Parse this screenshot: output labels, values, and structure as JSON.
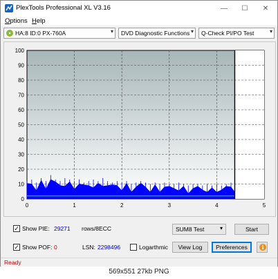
{
  "window": {
    "title": "PlexTools Professional XL V3.16",
    "minimize_glyph": "—",
    "maximize_glyph": "☐",
    "close_glyph": "✕"
  },
  "menu": [
    {
      "label": "Options",
      "underline": "O",
      "rest": "ptions"
    },
    {
      "label": "Help",
      "underline": "H",
      "rest": "elp"
    }
  ],
  "toolbar": {
    "drive": "HA:8 ID:0  PX-760A",
    "function": "DVD Diagnostic Functions",
    "test": "Q-Check PI/PO Test"
  },
  "chart_data": {
    "type": "area",
    "title": "",
    "xlabel": "",
    "ylabel": "",
    "xlim": [
      0,
      5
    ],
    "ylim": [
      0,
      100
    ],
    "x_ticks": [
      "0",
      "1",
      "2",
      "3",
      "4",
      "5"
    ],
    "y_ticks": [
      "0",
      "10",
      "20",
      "30",
      "40",
      "50",
      "60",
      "70",
      "80",
      "90",
      "100"
    ],
    "grid": true,
    "end_marker_x": 4.38,
    "series": [
      {
        "color": "#0000ff",
        "x": [
          0,
          0.1,
          0.2,
          0.3,
          0.4,
          0.5,
          0.6,
          0.7,
          0.8,
          0.9,
          1.0,
          1.1,
          1.2,
          1.3,
          1.4,
          1.5,
          1.6,
          1.7,
          1.8,
          1.9,
          2.0,
          2.1,
          2.2,
          2.3,
          2.4,
          2.5,
          2.6,
          2.7,
          2.8,
          2.9,
          3.0,
          3.1,
          3.2,
          3.3,
          3.4,
          3.5,
          3.6,
          3.7,
          3.8,
          3.9,
          4.0,
          4.1,
          4.2,
          4.3,
          4.38
        ],
        "values": [
          8,
          9,
          7,
          10,
          8,
          12,
          9,
          8,
          10,
          9,
          8,
          9,
          7,
          8,
          9,
          8,
          10,
          8,
          7,
          8,
          7,
          8,
          6,
          7,
          8,
          7,
          6,
          7,
          6,
          7,
          6,
          6,
          7,
          6,
          5,
          6,
          6,
          5,
          6,
          5,
          6,
          5,
          6,
          7,
          6
        ]
      },
      {
        "color": "#00ff00",
        "x": [
          0,
          4.38
        ],
        "values": [
          2,
          2
        ]
      }
    ]
  },
  "bottom": {
    "show_pie_label": "Show PIE:",
    "pie_value": "29271",
    "pie_unit": "rows/8ECC",
    "show_pof_label": "Show POF:",
    "pof_value": "0",
    "lsn_label": "LSN:",
    "lsn_value": "2298496",
    "logarithmic_label": "Logarthmic",
    "test_select": "SUM8 Test",
    "start_label": "Start",
    "view_log_label": "View Log",
    "preferences_label": "Preferences",
    "info_glyph": "i",
    "check_glyph": "✓"
  },
  "status": "Ready",
  "caption": "569x551  27kb  PNG",
  "colors": {
    "status_text": "#cc0000",
    "value_blue": "#0000cc",
    "value_red": "#cc0000"
  }
}
